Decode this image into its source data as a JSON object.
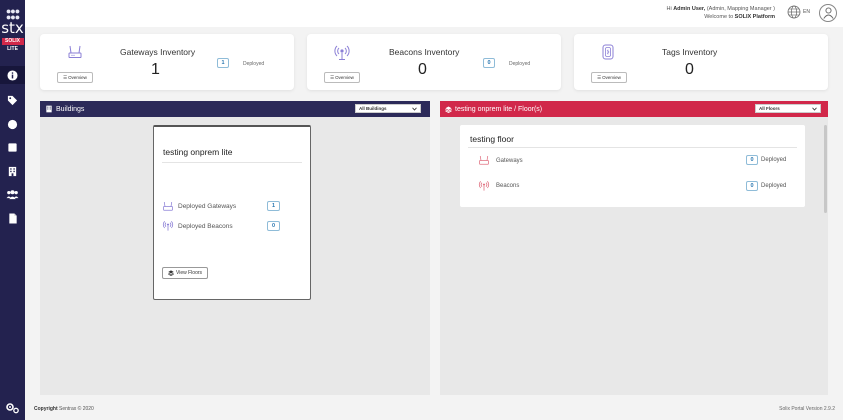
{
  "brand": {
    "logo_text": "stx",
    "badge": "SOLIX",
    "sub": "LITE"
  },
  "header": {
    "greeting_prefix": "Hi",
    "user_name": "Admin User,",
    "user_role": "(Admin, Mapping Manager )",
    "welcome_prefix": "Welcome to",
    "platform": "SOLIX Platform",
    "language": "EN"
  },
  "sidebar": {
    "items": [
      {
        "icon": "info-icon",
        "active": true
      },
      {
        "icon": "tag-icon"
      },
      {
        "icon": "circle-icon"
      },
      {
        "icon": "square-icon"
      },
      {
        "icon": "building-icon"
      },
      {
        "icon": "users-icon"
      },
      {
        "icon": "document-icon"
      }
    ],
    "settings_icon": "gears-icon"
  },
  "cards": [
    {
      "title": "Gateways Inventory",
      "count": "1",
      "deployed_count": "1",
      "deployed_label": "Deployed",
      "overview_label": "Overview",
      "icon": "gateway-icon"
    },
    {
      "title": "Beacons Inventory",
      "count": "0",
      "deployed_count": "0",
      "deployed_label": "Deployed",
      "overview_label": "Overview",
      "icon": "beacon-icon"
    },
    {
      "title": "Tags Inventory",
      "count": "0",
      "overview_label": "Overview",
      "icon": "tag-device-icon"
    }
  ],
  "buildings_panel": {
    "title": "Buildings",
    "filter_value": "All Buildings",
    "header_color": "#2c2a59",
    "building": {
      "name": "testing onprem lite",
      "rows": [
        {
          "label": "Deployed Gateways",
          "value": "1"
        },
        {
          "label": "Deployed Beacons",
          "value": "0"
        }
      ],
      "view_floors_label": "View Floors"
    }
  },
  "floors_panel": {
    "title": "testing onprem lite / Floor(s)",
    "filter_value": "All Floors",
    "header_color": "#d1284a",
    "floor": {
      "name": "testing floor",
      "rows": [
        {
          "label": "Gateways",
          "value": "0",
          "suffix": "Deployed"
        },
        {
          "label": "Beacons",
          "value": "0",
          "suffix": "Deployed"
        }
      ]
    }
  },
  "footer": {
    "copyright_label": "Copyright",
    "copyright_text": "Sentrax © 2020",
    "version": "Solix Portal Version 2.9.2"
  }
}
